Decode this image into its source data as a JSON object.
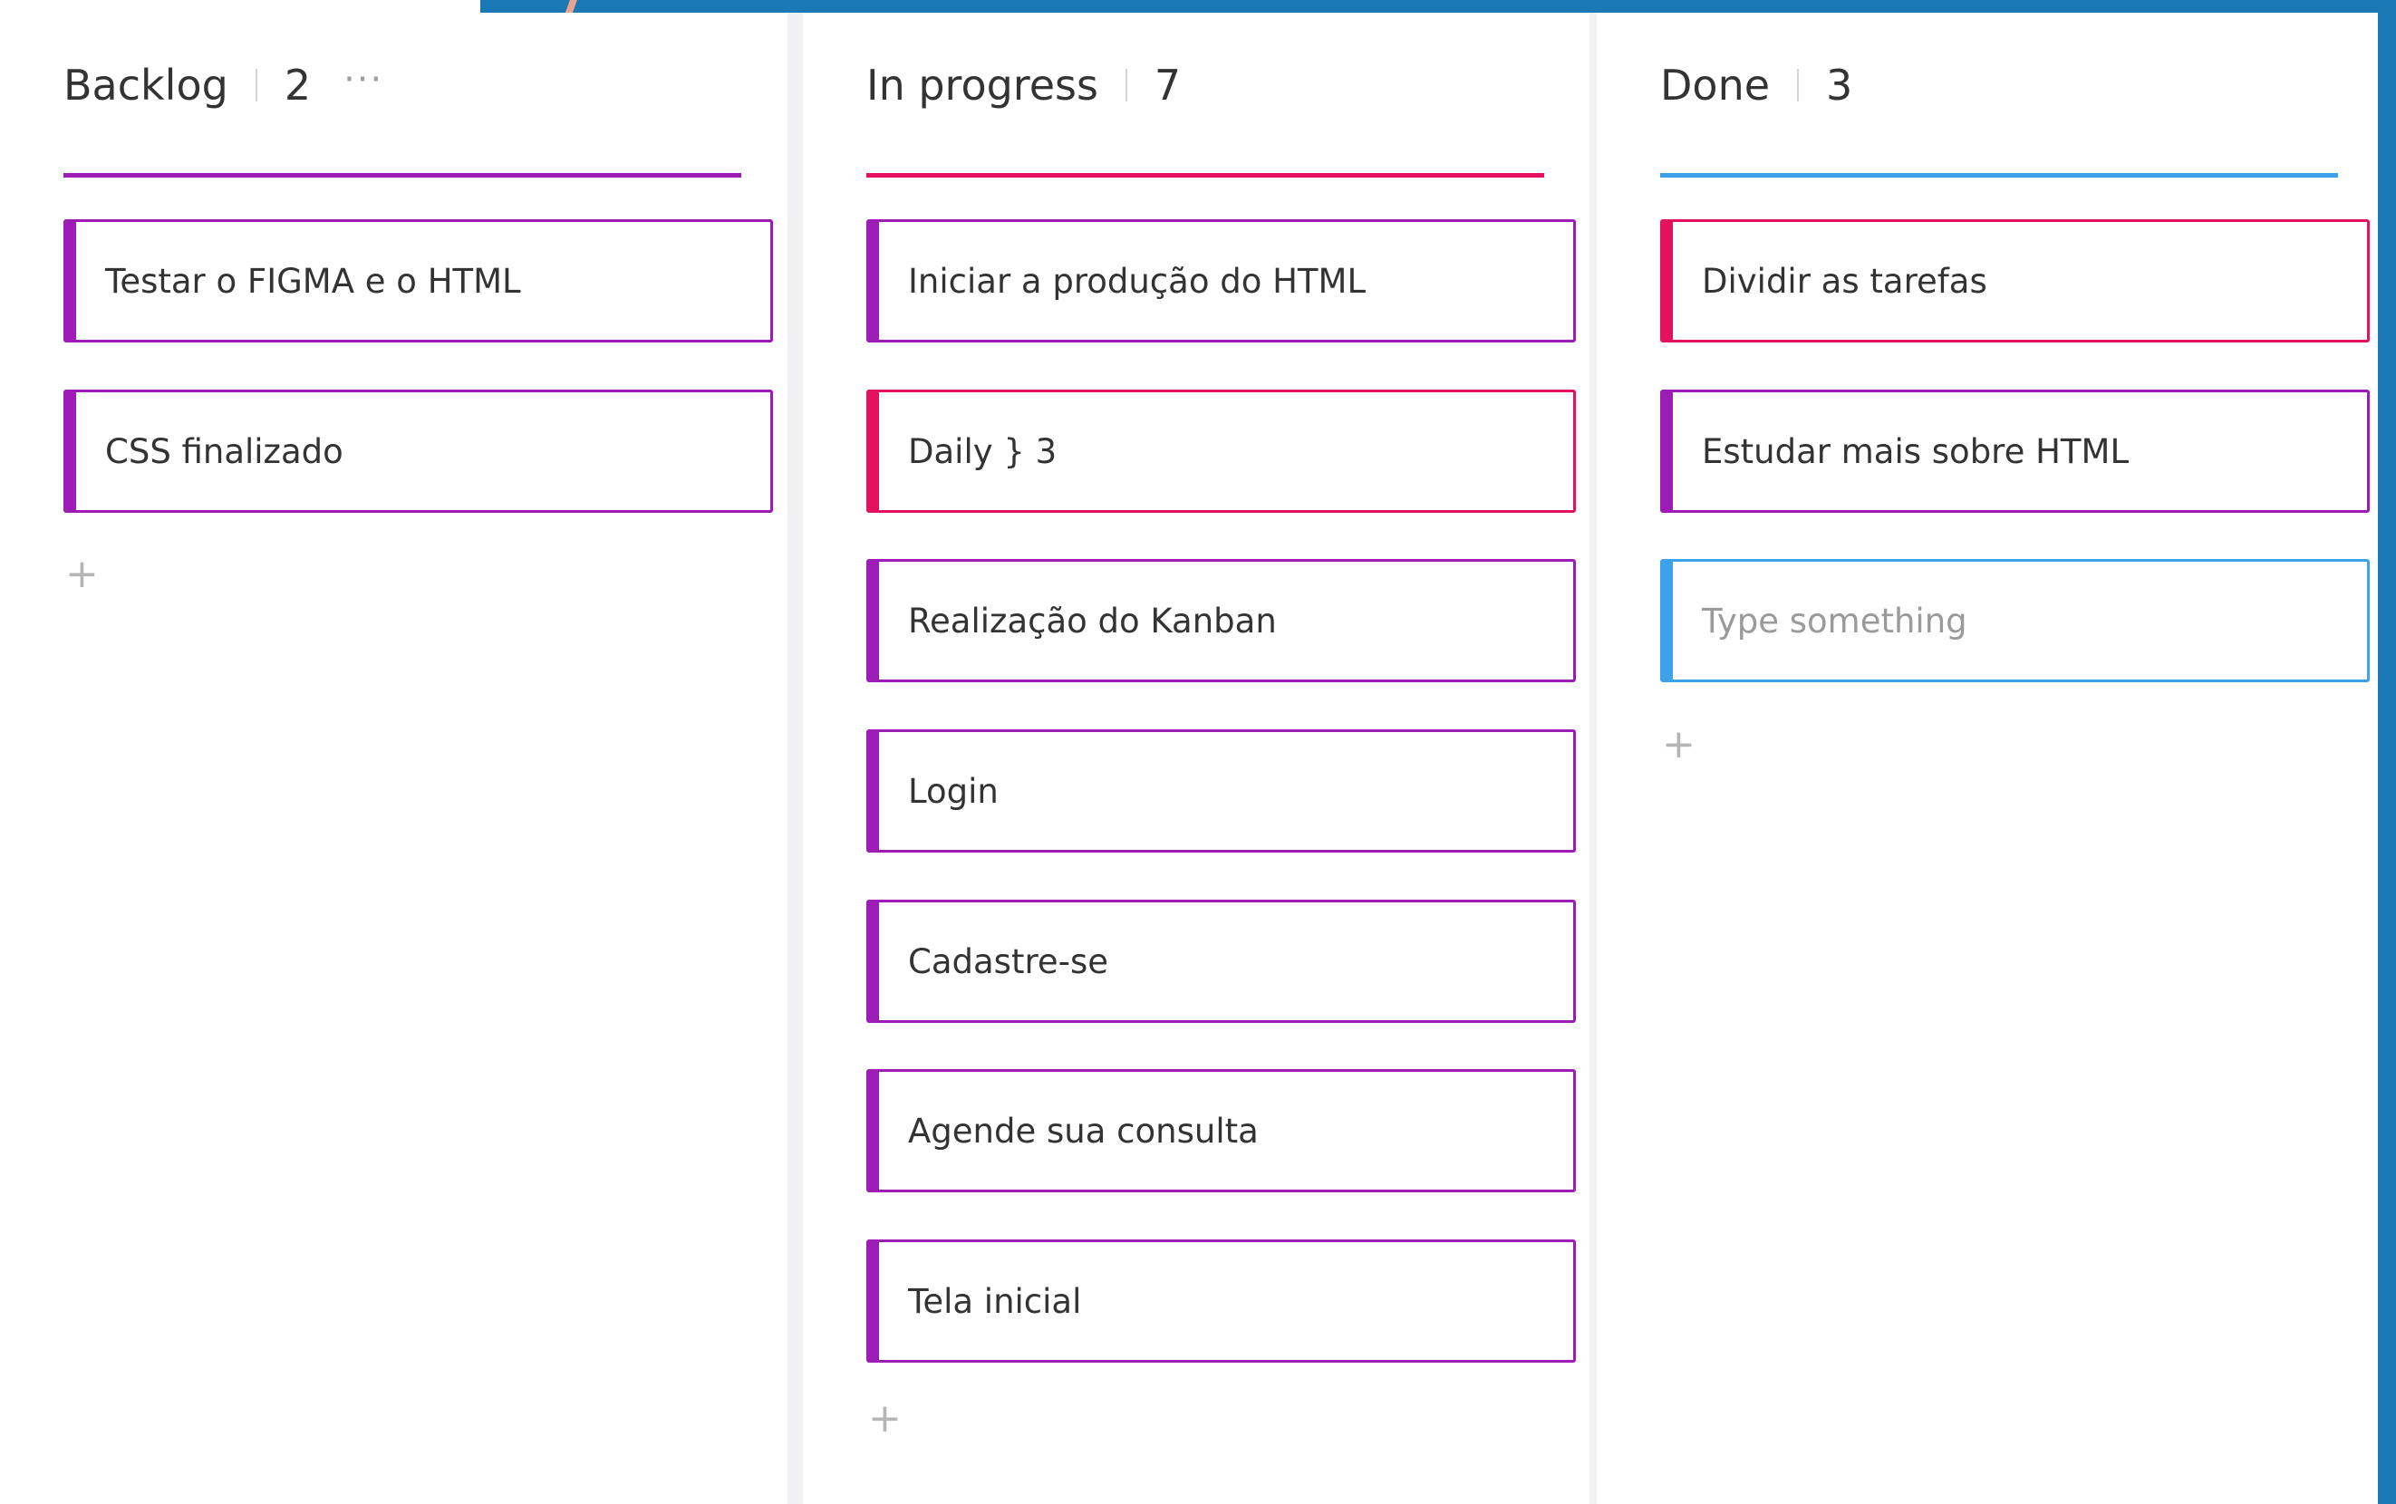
{
  "colors": {
    "frame_blue": "#1a78b4",
    "purple": "#9c1cb5",
    "pink": "#e3115e",
    "blue": "#3ea2ea",
    "text": "#333333"
  },
  "columns": [
    {
      "title": "Backlog",
      "count": "2",
      "more_icon": "ellipsis-icon",
      "more_label": "···",
      "line_color": "#9c1cb5",
      "cards": [
        {
          "text": "Testar o FIGMA e o HTML",
          "color": "#9c1cb5"
        },
        {
          "text": "CSS finalizado",
          "color": "#9c1cb5"
        }
      ],
      "add_label": "+"
    },
    {
      "title": "In progress",
      "count": "7",
      "line_color": "#e3115e",
      "cards": [
        {
          "text": "Iniciar a produção do HTML",
          "color": "#9c1cb5"
        },
        {
          "text": "Daily } 3",
          "color": "#e3115e"
        },
        {
          "text": "Realização do Kanban",
          "color": "#9c1cb5"
        },
        {
          "text": "Login",
          "color": "#9c1cb5"
        },
        {
          "text": "Cadastre-se",
          "color": "#9c1cb5"
        },
        {
          "text": "Agende sua consulta",
          "color": "#9c1cb5"
        },
        {
          "text": "Tela inicial",
          "color": "#9c1cb5"
        }
      ],
      "add_label": "+"
    },
    {
      "title": "Done",
      "count": "3",
      "line_color": "#3ea2ea",
      "cards": [
        {
          "text": "Dividir as tarefas",
          "color": "#e3115e"
        },
        {
          "text": "Estudar mais sobre HTML",
          "color": "#9c1cb5"
        }
      ],
      "new_card": {
        "placeholder": "Type something",
        "color": "#3ea2ea"
      },
      "add_label": "+"
    }
  ]
}
